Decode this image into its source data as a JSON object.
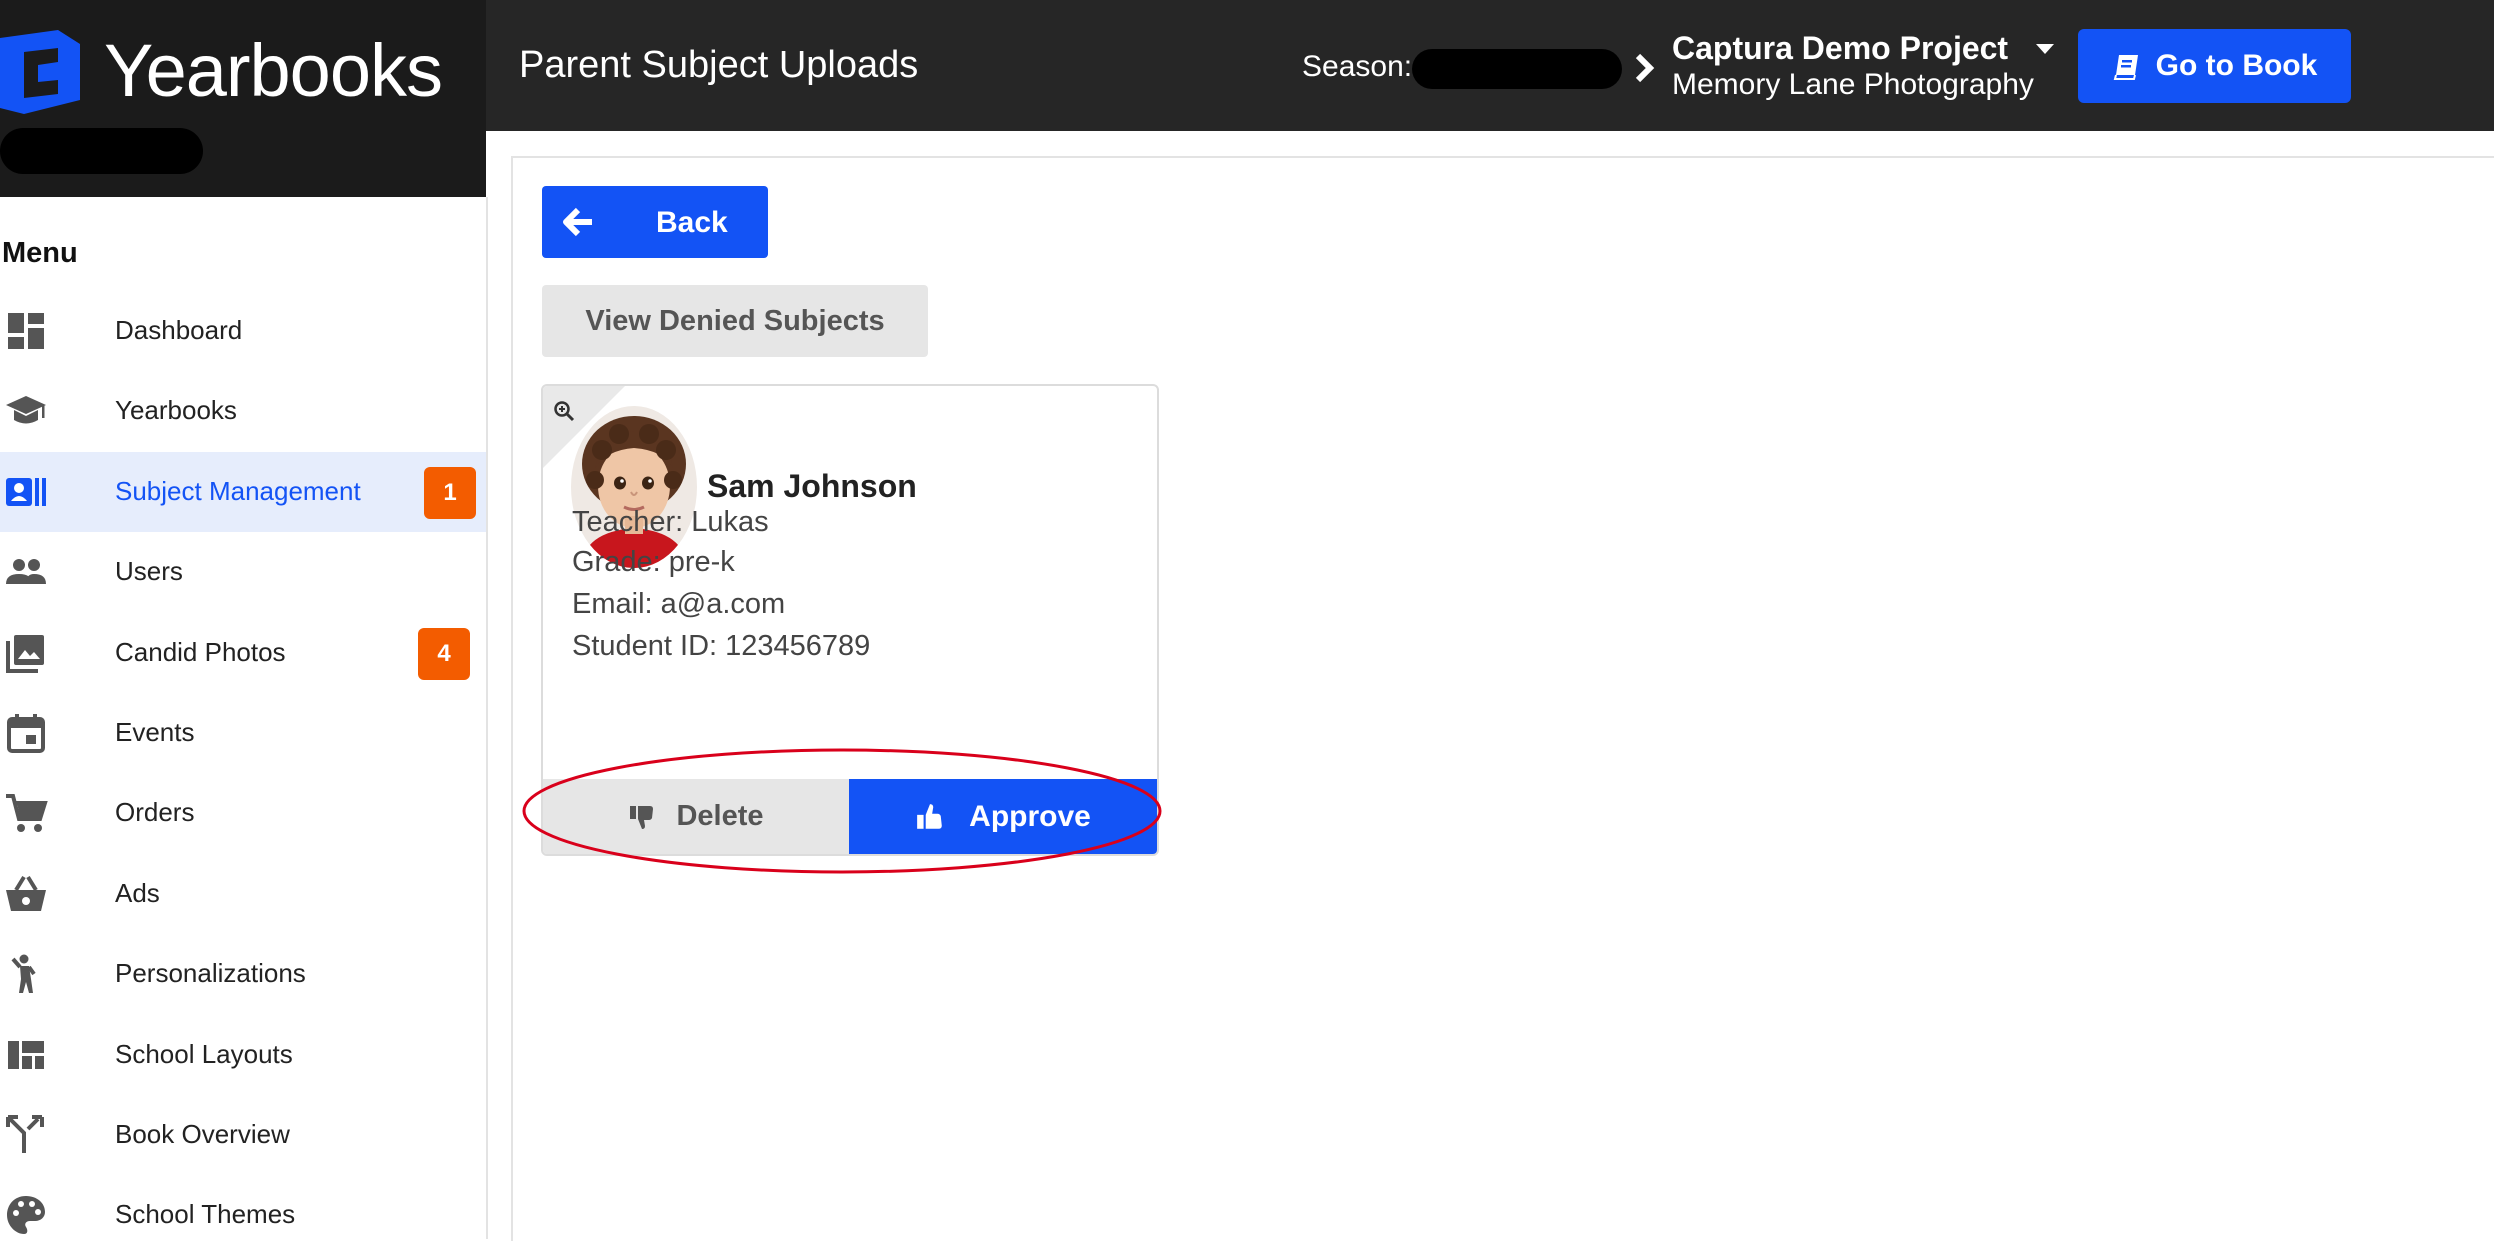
{
  "app": {
    "brand_name": "Yearbooks",
    "page_title": "Parent Subject Uploads"
  },
  "header": {
    "season_label": "Season:",
    "project_name": "Captura Demo Project",
    "studio_name": "Memory Lane Photography",
    "go_to_book_label": "Go to Book"
  },
  "sidebar": {
    "heading": "Menu",
    "items": [
      {
        "label": "Dashboard",
        "icon": "dashboard-icon"
      },
      {
        "label": "Yearbooks",
        "icon": "graduation-cap-icon"
      },
      {
        "label": "Subject Management",
        "icon": "contact-card-icon",
        "badge": "1",
        "active": true
      },
      {
        "label": "Users",
        "icon": "users-icon"
      },
      {
        "label": "Candid Photos",
        "icon": "photos-icon",
        "badge": "4"
      },
      {
        "label": "Events",
        "icon": "calendar-icon"
      },
      {
        "label": "Orders",
        "icon": "cart-icon"
      },
      {
        "label": "Ads",
        "icon": "basket-icon"
      },
      {
        "label": "Personalizations",
        "icon": "person-waving-icon"
      },
      {
        "label": "School Layouts",
        "icon": "layout-icon"
      },
      {
        "label": "Book Overview",
        "icon": "fork-arrows-icon"
      },
      {
        "label": "School Themes",
        "icon": "palette-icon"
      }
    ]
  },
  "main": {
    "back_label": "Back",
    "view_denied_label": "View Denied Subjects",
    "subject": {
      "name": "Sam Johnson",
      "teacher": "Teacher: Lukas",
      "grade": "Grade: pre-k",
      "email": "Email: a@a.com",
      "student_id": "Student ID: 123456789",
      "delete_label": "Delete",
      "approve_label": "Approve"
    }
  },
  "colors": {
    "topbar": "#262626",
    "brand_bg": "#1b1b1b",
    "primary": "#1353f5",
    "badge": "#f35c00",
    "active_bg": "#e6edfc",
    "highlight": "#d9001b"
  }
}
